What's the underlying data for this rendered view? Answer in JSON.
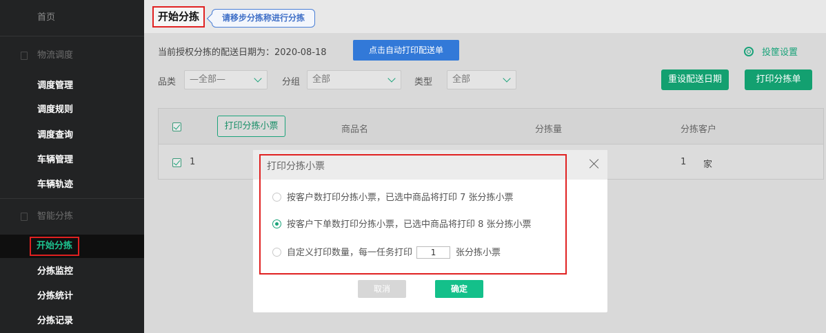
{
  "sidebar": {
    "home": "首页",
    "groups": [
      {
        "label": "物流调度",
        "items": [
          "调度管理",
          "调度规则",
          "调度查询",
          "车辆管理",
          "车辆轨迹"
        ]
      },
      {
        "label": "智能分拣",
        "items": [
          "开始分拣",
          "分拣监控",
          "分拣统计",
          "分拣记录"
        ]
      }
    ],
    "active_item": "开始分拣"
  },
  "header": {
    "title": "开始分拣",
    "hint": "请移步分拣称进行分拣"
  },
  "toolbar": {
    "date_text": "当前授权分拣的配送日期为：2020-08-18",
    "auto_print_button": "点击自动打印配送单",
    "settings_label": "投筐设置"
  },
  "filters": {
    "category_label": "品类",
    "category_value": "—全部—",
    "group_label": "分组",
    "group_value": "全部",
    "type_label": "类型",
    "type_value": "全部",
    "reset_date_button": "重设配送日期",
    "print_sort_button": "打印分拣单"
  },
  "table": {
    "print_ticket_button": "打印分拣小票",
    "columns": [
      "商品名",
      "分拣量",
      "分拣客户"
    ],
    "rows": [
      {
        "index": "1",
        "customer_count": "1",
        "customer_unit": "家"
      }
    ]
  },
  "dialog": {
    "title": "打印分拣小票",
    "options": [
      "按客户数打印分拣小票，已选中商品将打印 7 张分拣小票",
      "按客户下单数打印分拣小票，已选中商品将打印 8 张分拣小票"
    ],
    "custom_prefix": "自定义打印数量，每一任务打印",
    "custom_value": "1",
    "custom_suffix": "张分拣小票",
    "selected_option": 1,
    "cancel_button": "取消",
    "ok_button": "确定"
  },
  "colors": {
    "accent": "#1aa37a",
    "primary_blue": "#3279d8",
    "highlight_red": "#e02020",
    "sidebar_bg": "#222324"
  }
}
